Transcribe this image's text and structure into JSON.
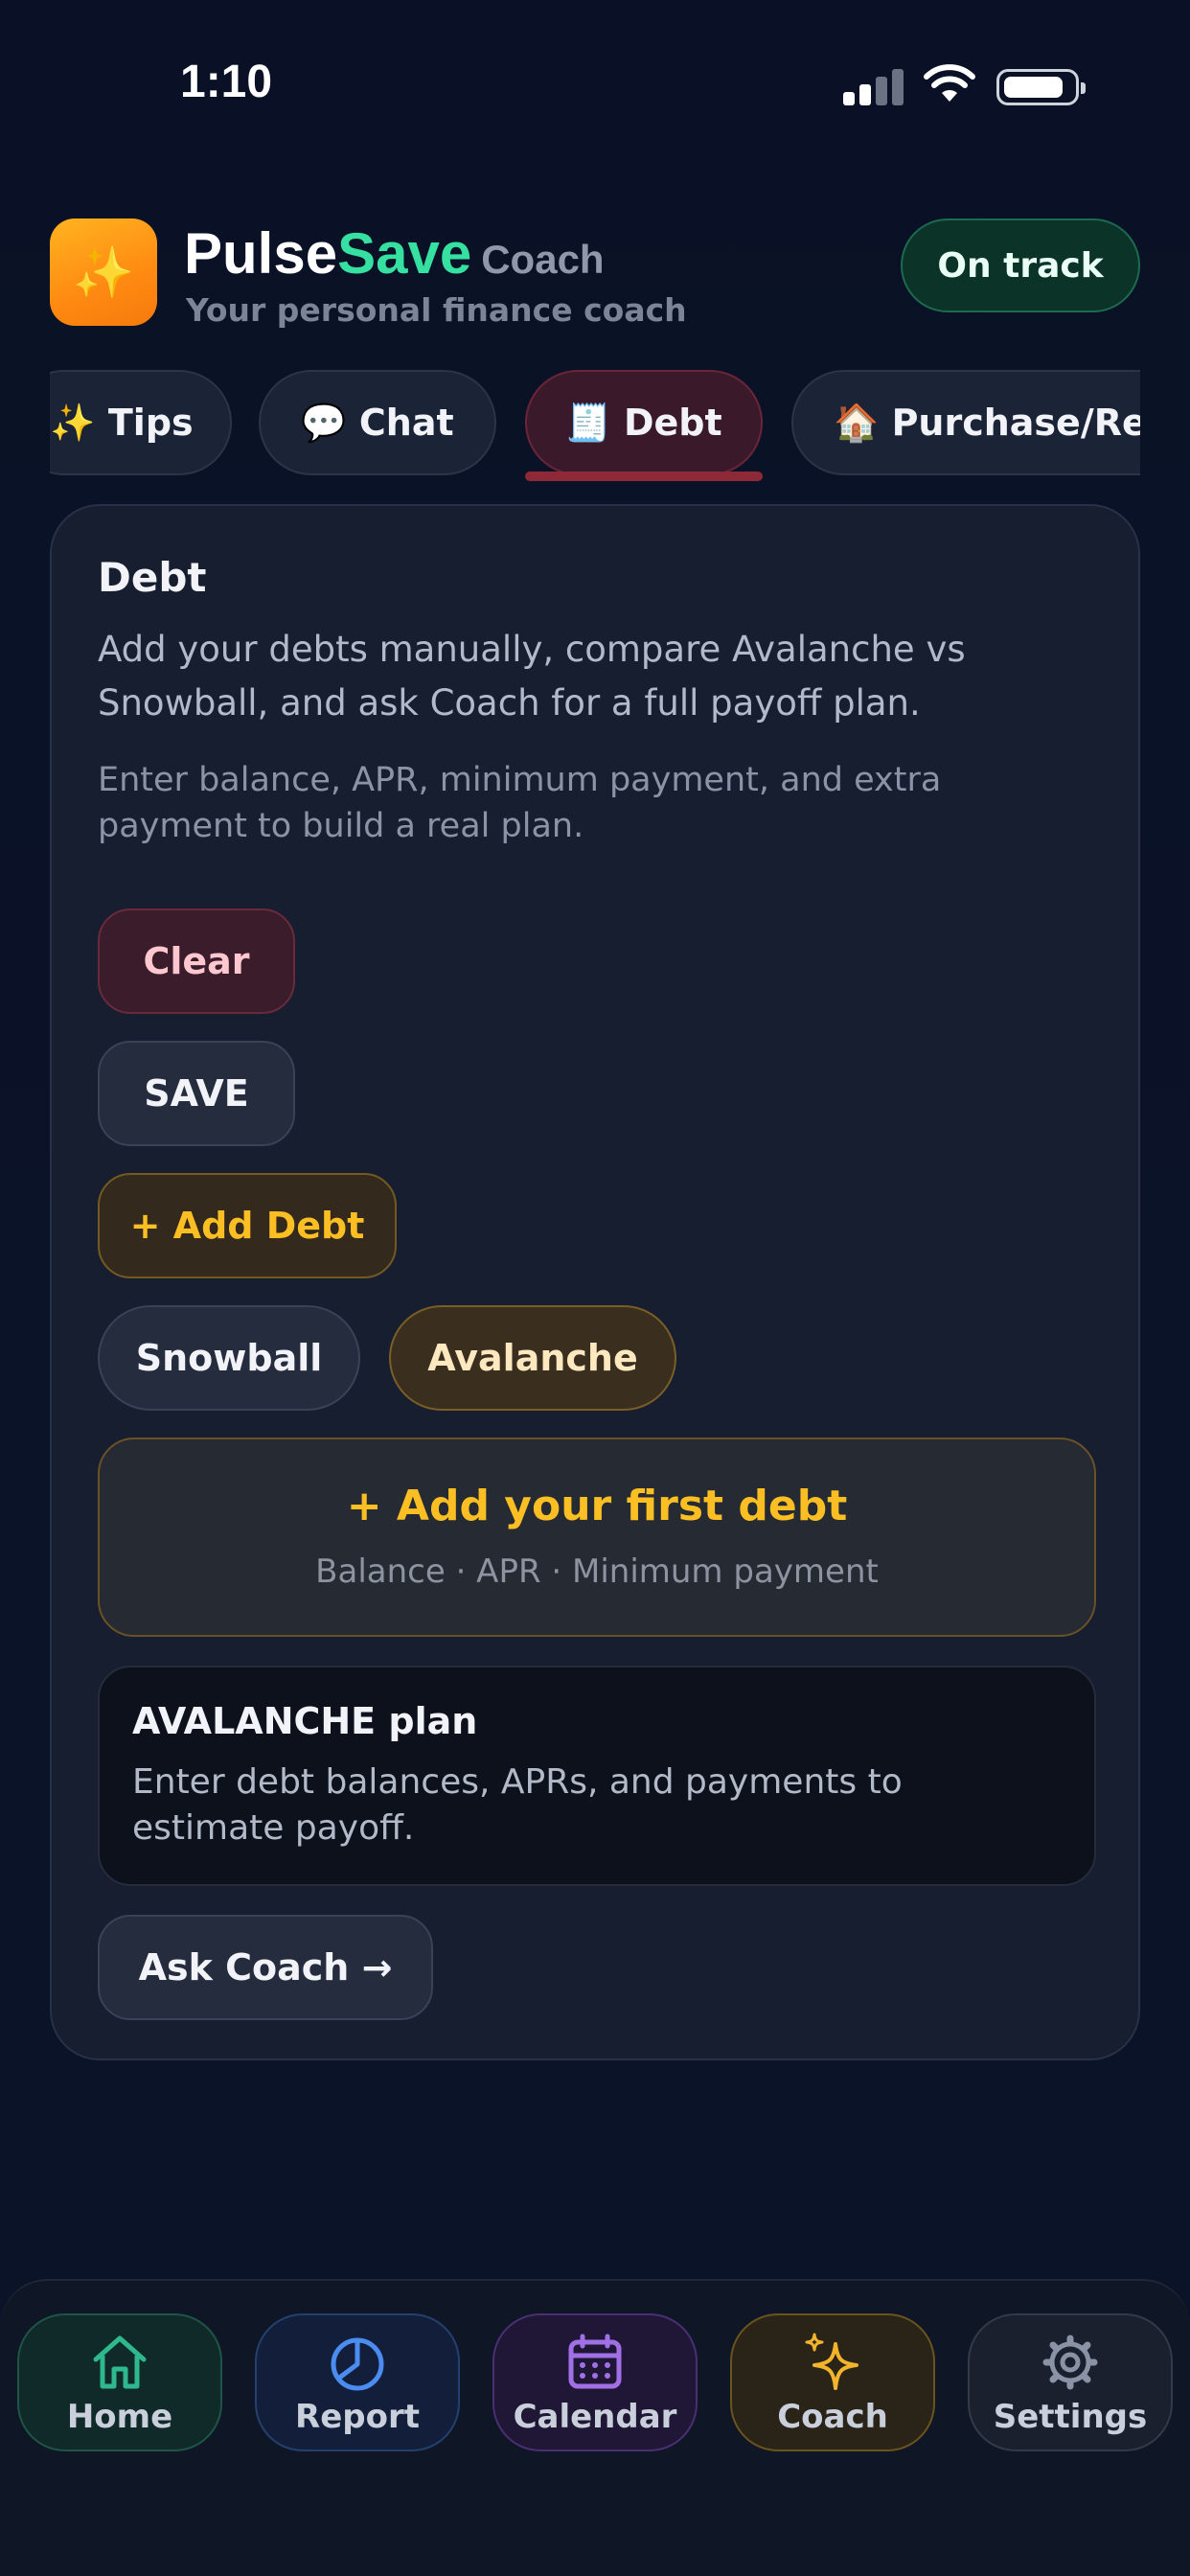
{
  "status_bar": {
    "time": "1:10"
  },
  "header": {
    "logo_glyph": "✨",
    "brand_part1": "Pulse",
    "brand_part2": "Save",
    "brand_suffix": "Coach",
    "subtitle": "Your personal finance coach",
    "status_pill": "On track"
  },
  "tabs": [
    {
      "icon": "✨",
      "label": "Tips"
    },
    {
      "icon": "💬",
      "label": "Chat"
    },
    {
      "icon": "🧾",
      "label": "Debt"
    },
    {
      "icon": "🏠",
      "label": "Purchase/Re"
    }
  ],
  "active_tab": "Debt",
  "debt_card": {
    "title": "Debt",
    "description": "Add your debts manually, compare Avalanche vs Snowball, and ask Coach for a full payoff plan.",
    "hint": "Enter balance, APR, minimum payment, and extra payment to build a real plan.",
    "clear_label": "Clear",
    "save_label": "SAVE",
    "add_debt_label": "+ Add Debt",
    "strategy_snowball": "Snowball",
    "strategy_avalanche": "Avalanche",
    "selected_strategy": "Avalanche",
    "first_debt_title": "+ Add your first debt",
    "first_debt_fields": "Balance · APR · Minimum payment",
    "plan_title": "AVALANCHE plan",
    "plan_text": "Enter debt balances, APRs, and payments to estimate payoff.",
    "ask_coach_label": "Ask Coach →"
  },
  "bottom_nav": {
    "home": "Home",
    "report": "Report",
    "calendar": "Calendar",
    "coach": "Coach",
    "settings": "Settings"
  },
  "colors": {
    "accent_green": "#35e0a1",
    "accent_amber": "#fbbf24",
    "background": "#0b1328"
  }
}
